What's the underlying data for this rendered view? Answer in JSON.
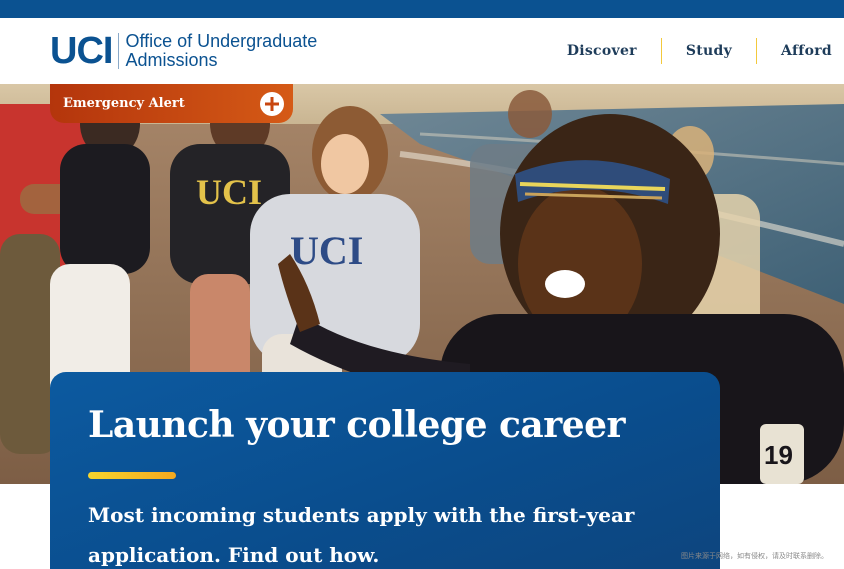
{
  "site": {
    "logo_mark": "UCI",
    "office_line1": "Office of Undergraduate",
    "office_line2": "Admissions"
  },
  "nav": {
    "items": [
      {
        "label": "Discover"
      },
      {
        "label": "Study"
      },
      {
        "label": "Afford"
      }
    ]
  },
  "alert": {
    "label": "Emergency Alert",
    "icon": "plus-circle-icon"
  },
  "hero": {
    "image": "students-running-on-beach-photo",
    "card": {
      "title": "Launch your college career",
      "description": "Most incoming students apply with the first-year application. Find out how."
    }
  },
  "watermark": "图片来源于网络，如有侵权，请及时联系删除。",
  "colors": {
    "brand_blue": "#0b5291",
    "alert_orange": "#c8460f",
    "accent_gold": "#f3c93c"
  }
}
